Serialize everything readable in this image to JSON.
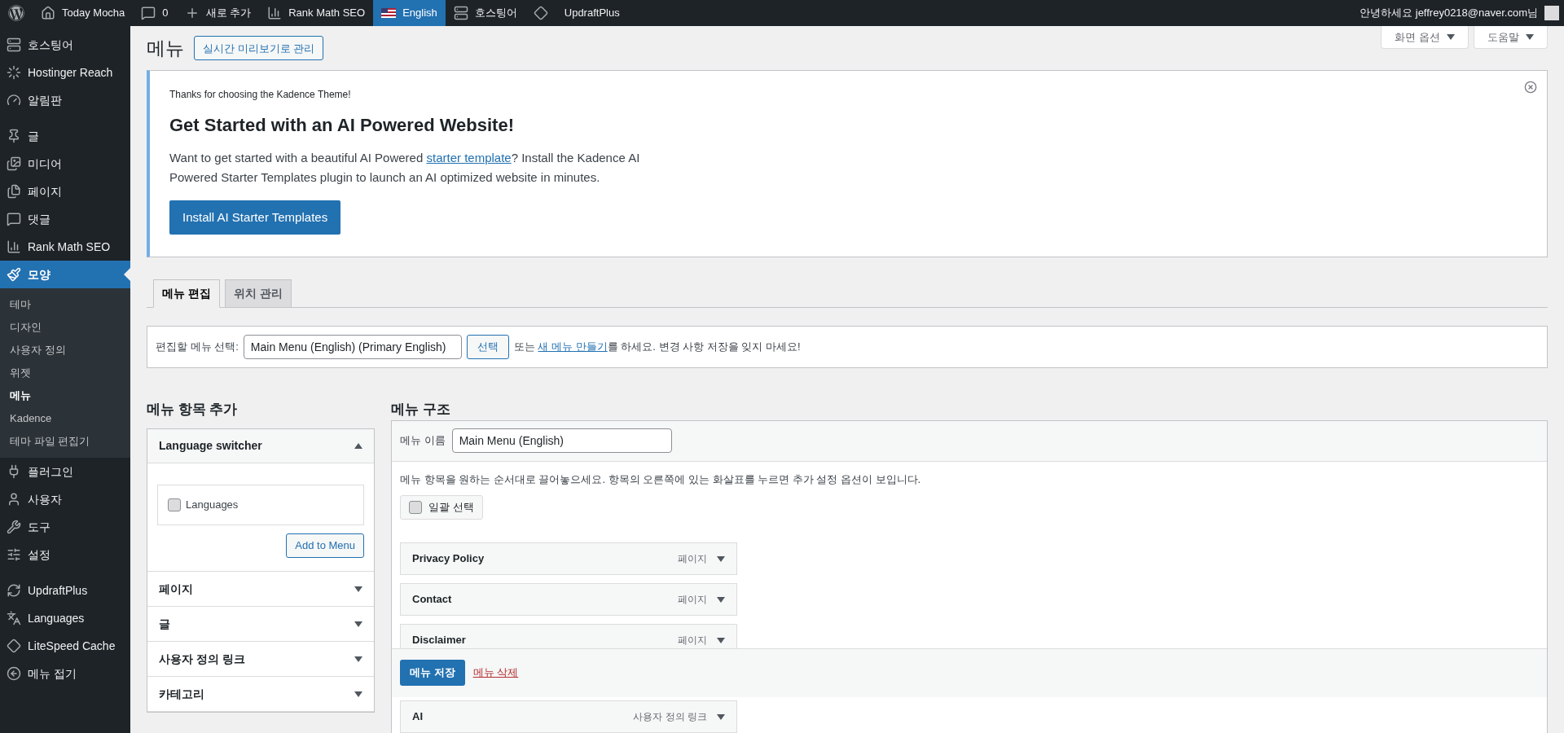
{
  "admin_bar": {
    "items": [
      {
        "kind": "wp",
        "selected": false
      },
      {
        "kind": "home",
        "label": "Today Mocha",
        "selected": false
      },
      {
        "kind": "comments",
        "label": "0",
        "selected": false
      },
      {
        "kind": "new",
        "label": "새로 추가",
        "selected": false
      },
      {
        "kind": "rankmath",
        "label": "Rank Math SEO",
        "selected": false
      },
      {
        "kind": "flag",
        "label": "English",
        "selected": true
      },
      {
        "kind": "hostinger",
        "label": "호스팅어",
        "selected": false
      },
      {
        "kind": "litespeed",
        "selected": false
      },
      {
        "kind": "updraft",
        "label": "UpdraftPlus",
        "selected": false
      }
    ],
    "greeting": "안녕하세요 jeffrey0218@naver.com님"
  },
  "sidebar": {
    "groups": [
      [
        {
          "kind": "hostinger",
          "label": "호스팅어",
          "selected": false
        },
        {
          "kind": "reach",
          "label": "Hostinger Reach",
          "selected": false
        },
        {
          "kind": "dashboard",
          "label": "알림판",
          "selected": false
        }
      ],
      [
        {
          "kind": "pin",
          "label": "글",
          "selected": false
        },
        {
          "kind": "media",
          "label": "미디어",
          "selected": false
        },
        {
          "kind": "pages",
          "label": "페이지",
          "selected": false
        },
        {
          "kind": "comments",
          "label": "댓글",
          "selected": false
        },
        {
          "kind": "rankmath",
          "label": "Rank Math SEO",
          "selected": false
        },
        {
          "kind": "brush",
          "label": "모양",
          "selected": true,
          "children": [
            {
              "label": "테마",
              "selected": false
            },
            {
              "label": "디자인",
              "selected": false
            },
            {
              "label": "사용자 정의",
              "selected": false
            },
            {
              "label": "위젯",
              "selected": false
            },
            {
              "label": "메뉴",
              "selected": true
            },
            {
              "label": "Kadence",
              "selected": false
            },
            {
              "label": "테마 파일 편집기",
              "selected": false
            }
          ]
        },
        {
          "kind": "plugin",
          "label": "플러그인",
          "selected": false
        },
        {
          "kind": "user",
          "label": "사용자",
          "selected": false
        },
        {
          "kind": "wrench",
          "label": "도구",
          "selected": false
        },
        {
          "kind": "settings",
          "label": "설정",
          "selected": false
        }
      ],
      [
        {
          "kind": "updraft",
          "label": "UpdraftPlus",
          "selected": false
        },
        {
          "kind": "languages",
          "label": "Languages",
          "selected": false
        },
        {
          "kind": "litespeed",
          "label": "LiteSpeed Cache",
          "selected": false
        },
        {
          "kind": "collapse",
          "label": "메뉴 접기",
          "selected": false
        }
      ]
    ]
  },
  "screen_buttons": [
    "화면 옵션",
    "도움말"
  ],
  "page_title": "메뉴",
  "preview_button": "실시간 미리보기로 관리",
  "notice": {
    "eyebrow": "Thanks for choosing the Kadence Theme!",
    "heading": "Get Started with an AI Powered Website!",
    "text_before": "Want to get started with a beautiful AI Powered ",
    "link": "starter template",
    "text_after": "? Install the Kadence AI Powered Starter Templates plugin to launch an AI optimized website in minutes.",
    "button": "Install AI Starter Templates"
  },
  "tabs": [
    {
      "label": "메뉴 편집",
      "selected": true
    },
    {
      "label": "위치 관리",
      "selected": false
    }
  ],
  "select_bar": {
    "label": "편집할 메뉴 선택:",
    "value": "Main Menu (English) (Primary English)",
    "button": "선택",
    "text_before": "또는 ",
    "link": "새 메뉴 만들기",
    "text_after": "를 하세요. 변경 사항 저장을 잊지 마세요!"
  },
  "add_items": {
    "heading": "메뉴 항목 추가",
    "sections": [
      {
        "title": "Language switcher",
        "expanded": true,
        "options": [
          {
            "label": "Languages",
            "checked": false
          }
        ],
        "button": "Add to Menu"
      },
      {
        "title": "페이지",
        "expanded": false
      },
      {
        "title": "글",
        "expanded": false
      },
      {
        "title": "사용자 정의 링크",
        "expanded": false
      },
      {
        "title": "카테고리",
        "expanded": false
      }
    ]
  },
  "structure": {
    "heading": "메뉴 구조",
    "name_label": "메뉴 이름",
    "name_value": "Main Menu (English)",
    "instructions": "메뉴 항목을 원하는 순서대로 끌어놓으세요. 항목의 오른쪽에 있는 화살표를 누르면 추가 설정 옵션이 보입니다.",
    "bulk": {
      "label": "일괄 선택",
      "checked": false
    },
    "items": [
      {
        "title": "Privacy Policy",
        "type": "페이지"
      },
      {
        "title": "Contact",
        "type": "페이지"
      },
      {
        "title": "Disclaimer",
        "type": "페이지"
      },
      {
        "title": "AI",
        "type": "사용자 정의 링크"
      }
    ],
    "save_button": "메뉴 저장",
    "delete_link": "메뉴 삭제"
  }
}
